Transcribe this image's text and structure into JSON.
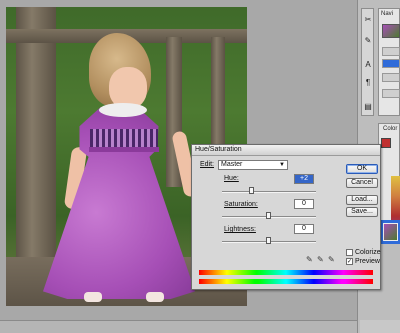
{
  "dialog": {
    "title": "Hue/Saturation",
    "edit_label": "Edit:",
    "edit_value": "Master",
    "hue_label": "Hue:",
    "hue_value": "+2",
    "saturation_label": "Saturation:",
    "saturation_value": "0",
    "lightness_label": "Lightness:",
    "lightness_value": "0",
    "buttons": {
      "ok": "OK",
      "cancel": "Cancel",
      "load": "Load...",
      "save": "Save..."
    },
    "colorize_label": "Colorize",
    "preview_label": "Preview",
    "colorize_checked": false,
    "preview_checked": true
  },
  "panels": {
    "navigator_tab": "Navi",
    "color_tab": "Color"
  },
  "icons": {
    "tools": [
      "move-tool-icon",
      "brush-tool-icon",
      "type-tool-icon",
      "paragraph-tool-icon",
      "ruler-tool-icon"
    ],
    "eyedroppers": [
      "eyedropper-icon",
      "eyedropper-plus-icon",
      "eyedropper-minus-icon"
    ]
  },
  "colors": {
    "accent_selection": "#2f6bd9",
    "dialog_bg": "#d7d7d7",
    "dress_purple": "#a64fb6"
  }
}
